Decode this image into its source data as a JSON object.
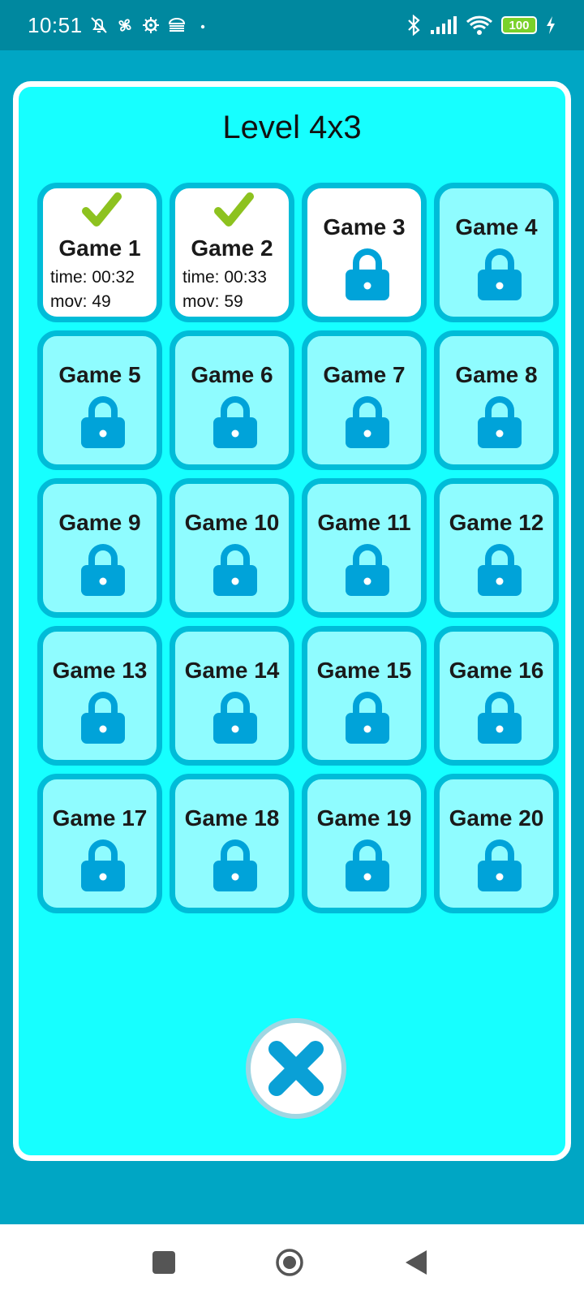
{
  "status_bar": {
    "time": "10:51",
    "battery": "100",
    "icons": [
      "alarm-off-icon",
      "fan-icon",
      "gear-icon",
      "vpn-icon",
      "dot-icon",
      "bluetooth-icon",
      "signal-icon",
      "wifi-icon",
      "battery-icon",
      "charging-icon"
    ]
  },
  "title": "Level 4x3",
  "games": [
    {
      "name": "Game 1",
      "state": "completed",
      "time": "time: 00:32",
      "moves": "mov: 49"
    },
    {
      "name": "Game 2",
      "state": "completed",
      "time": "time: 00:33",
      "moves": "mov: 59"
    },
    {
      "name": "Game 3",
      "state": "unlocked"
    },
    {
      "name": "Game 4",
      "state": "locked"
    },
    {
      "name": "Game 5",
      "state": "locked"
    },
    {
      "name": "Game 6",
      "state": "locked"
    },
    {
      "name": "Game 7",
      "state": "locked"
    },
    {
      "name": "Game 8",
      "state": "locked"
    },
    {
      "name": "Game 9",
      "state": "locked"
    },
    {
      "name": "Game 10",
      "state": "locked"
    },
    {
      "name": "Game 11",
      "state": "locked"
    },
    {
      "name": "Game 12",
      "state": "locked"
    },
    {
      "name": "Game 13",
      "state": "locked"
    },
    {
      "name": "Game 14",
      "state": "locked"
    },
    {
      "name": "Game 15",
      "state": "locked"
    },
    {
      "name": "Game 16",
      "state": "locked"
    },
    {
      "name": "Game 17",
      "state": "locked"
    },
    {
      "name": "Game 18",
      "state": "locked"
    },
    {
      "name": "Game 19",
      "state": "locked"
    },
    {
      "name": "Game 20",
      "state": "locked"
    }
  ],
  "colors": {
    "background": "#00a6c4",
    "panel": "#16ffff",
    "tile_locked": "#8ffcff",
    "tile_open": "#ffffff",
    "tile_border": "#00bcd8",
    "lock_icon": "#00a3d9",
    "check_icon": "#8dc21f"
  },
  "close_button": {
    "icon": "close-icon"
  },
  "nav_bar": {
    "icons": [
      "recents-icon",
      "home-icon",
      "back-icon"
    ]
  }
}
